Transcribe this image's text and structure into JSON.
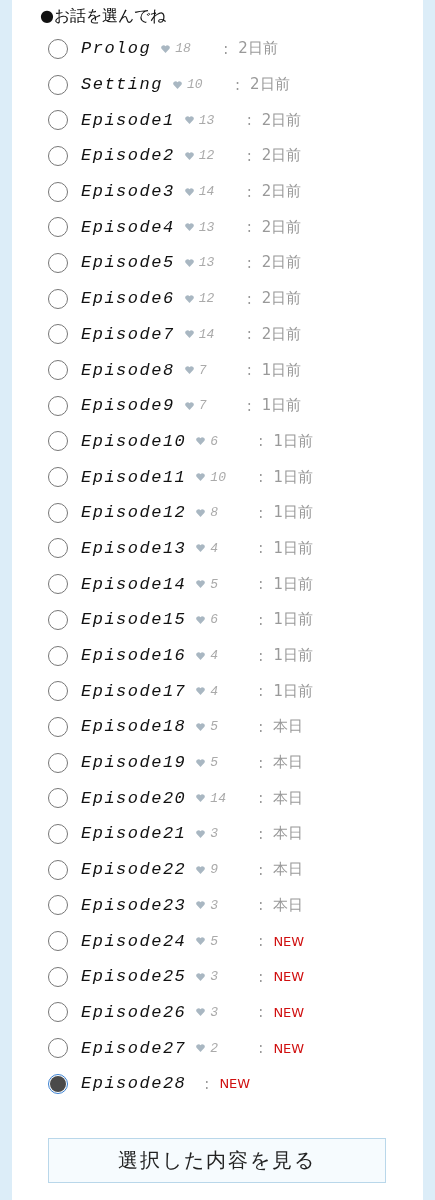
{
  "heading": "●お話を選んでね",
  "episodes": [
    {
      "title": "Prolog",
      "likes": "18",
      "age": "2日前",
      "kind": "ago",
      "selected": false
    },
    {
      "title": "Setting",
      "likes": "10",
      "age": "2日前",
      "kind": "ago",
      "selected": false
    },
    {
      "title": "Episode1",
      "likes": "13",
      "age": "2日前",
      "kind": "ago",
      "selected": false
    },
    {
      "title": "Episode2",
      "likes": "12",
      "age": "2日前",
      "kind": "ago",
      "selected": false
    },
    {
      "title": "Episode3",
      "likes": "14",
      "age": "2日前",
      "kind": "ago",
      "selected": false
    },
    {
      "title": "Episode4",
      "likes": "13",
      "age": "2日前",
      "kind": "ago",
      "selected": false
    },
    {
      "title": "Episode5",
      "likes": "13",
      "age": "2日前",
      "kind": "ago",
      "selected": false
    },
    {
      "title": "Episode6",
      "likes": "12",
      "age": "2日前",
      "kind": "ago",
      "selected": false
    },
    {
      "title": "Episode7",
      "likes": "14",
      "age": "2日前",
      "kind": "ago",
      "selected": false
    },
    {
      "title": "Episode8",
      "likes": "7",
      "age": "1日前",
      "kind": "ago",
      "selected": false
    },
    {
      "title": "Episode9",
      "likes": "7",
      "age": "1日前",
      "kind": "ago",
      "selected": false
    },
    {
      "title": "Episode10",
      "likes": "6",
      "age": "1日前",
      "kind": "ago",
      "selected": false
    },
    {
      "title": "Episode11",
      "likes": "10",
      "age": "1日前",
      "kind": "ago",
      "selected": false
    },
    {
      "title": "Episode12",
      "likes": "8",
      "age": "1日前",
      "kind": "ago",
      "selected": false
    },
    {
      "title": "Episode13",
      "likes": "4",
      "age": "1日前",
      "kind": "ago",
      "selected": false
    },
    {
      "title": "Episode14",
      "likes": "5",
      "age": "1日前",
      "kind": "ago",
      "selected": false
    },
    {
      "title": "Episode15",
      "likes": "6",
      "age": "1日前",
      "kind": "ago",
      "selected": false
    },
    {
      "title": "Episode16",
      "likes": "4",
      "age": "1日前",
      "kind": "ago",
      "selected": false
    },
    {
      "title": "Episode17",
      "likes": "4",
      "age": "1日前",
      "kind": "ago",
      "selected": false
    },
    {
      "title": "Episode18",
      "likes": "5",
      "age": "本日",
      "kind": "ago",
      "selected": false
    },
    {
      "title": "Episode19",
      "likes": "5",
      "age": "本日",
      "kind": "ago",
      "selected": false
    },
    {
      "title": "Episode20",
      "likes": "14",
      "age": "本日",
      "kind": "ago",
      "selected": false
    },
    {
      "title": "Episode21",
      "likes": "3",
      "age": "本日",
      "kind": "ago",
      "selected": false
    },
    {
      "title": "Episode22",
      "likes": "9",
      "age": "本日",
      "kind": "ago",
      "selected": false
    },
    {
      "title": "Episode23",
      "likes": "3",
      "age": "本日",
      "kind": "ago",
      "selected": false
    },
    {
      "title": "Episode24",
      "likes": "5",
      "age": "NEW",
      "kind": "new",
      "selected": false
    },
    {
      "title": "Episode25",
      "likes": "3",
      "age": "NEW",
      "kind": "new",
      "selected": false
    },
    {
      "title": "Episode26",
      "likes": "3",
      "age": "NEW",
      "kind": "new",
      "selected": false
    },
    {
      "title": "Episode27",
      "likes": "2",
      "age": "NEW",
      "kind": "new",
      "selected": false
    },
    {
      "title": "Episode28",
      "age": "NEW",
      "kind": "new",
      "selected": true
    }
  ],
  "separator": ":",
  "button": "選択した内容を見る"
}
